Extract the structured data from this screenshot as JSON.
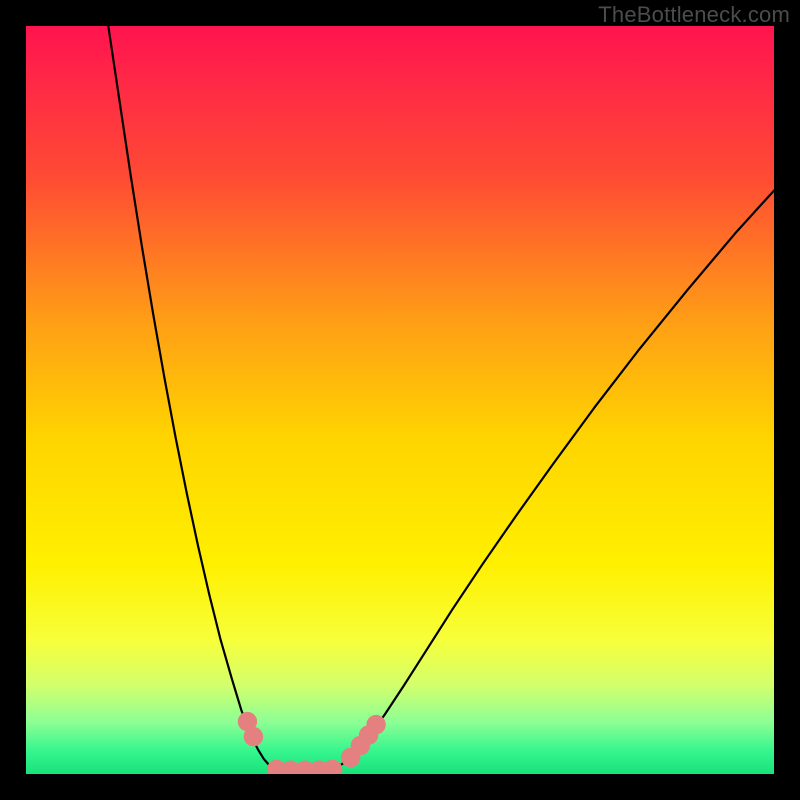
{
  "watermark": "TheBottleneck.com",
  "chart_data": {
    "type": "line",
    "title": "",
    "xlabel": "",
    "ylabel": "",
    "xlim": [
      0,
      100
    ],
    "ylim": [
      0,
      100
    ],
    "grid": false,
    "legend": false,
    "gradient_stops": [
      {
        "offset": 0.0,
        "color": "#ff1450"
      },
      {
        "offset": 0.2,
        "color": "#ff4a34"
      },
      {
        "offset": 0.4,
        "color": "#ffa015"
      },
      {
        "offset": 0.55,
        "color": "#ffd400"
      },
      {
        "offset": 0.72,
        "color": "#fff000"
      },
      {
        "offset": 0.82,
        "color": "#f7ff3a"
      },
      {
        "offset": 0.88,
        "color": "#d4ff6b"
      },
      {
        "offset": 0.93,
        "color": "#8dff94"
      },
      {
        "offset": 0.97,
        "color": "#35f58e"
      },
      {
        "offset": 1.0,
        "color": "#18e27b"
      }
    ],
    "series": [
      {
        "name": "left-curve",
        "stroke": "#000000",
        "stroke_width": 2.2,
        "x": [
          11.0,
          12.5,
          14.0,
          15.5,
          17.0,
          18.5,
          20.0,
          21.5,
          23.0,
          24.5,
          26.0,
          27.5,
          28.8,
          30.0,
          31.0,
          31.8,
          32.5,
          33.0,
          33.4
        ],
        "y": [
          100.0,
          90.0,
          80.0,
          70.5,
          61.5,
          53.0,
          45.0,
          37.5,
          30.5,
          24.0,
          18.0,
          12.8,
          8.5,
          5.3,
          3.3,
          2.0,
          1.2,
          0.7,
          0.5
        ]
      },
      {
        "name": "flat-bottom",
        "stroke": "#000000",
        "stroke_width": 2.2,
        "x": [
          33.4,
          35.0,
          37.0,
          39.0,
          41.0
        ],
        "y": [
          0.5,
          0.4,
          0.4,
          0.4,
          0.5
        ]
      },
      {
        "name": "right-curve",
        "stroke": "#000000",
        "stroke_width": 2.2,
        "x": [
          41.0,
          42.5,
          44.0,
          46.0,
          48.0,
          50.5,
          53.5,
          57.0,
          61.0,
          65.5,
          70.5,
          76.0,
          82.0,
          88.5,
          95.0,
          100.0
        ],
        "y": [
          0.5,
          1.5,
          3.0,
          5.2,
          8.0,
          11.8,
          16.5,
          22.0,
          28.0,
          34.5,
          41.5,
          49.0,
          56.8,
          64.8,
          72.5,
          78.0
        ]
      }
    ],
    "markers": [
      {
        "cx": 29.6,
        "cy": 7.0,
        "r": 1.3,
        "fill": "#e58080"
      },
      {
        "cx": 30.4,
        "cy": 5.0,
        "r": 1.3,
        "fill": "#e58080"
      },
      {
        "cx": 33.5,
        "cy": 0.6,
        "r": 1.3,
        "fill": "#e58080"
      },
      {
        "cx": 35.4,
        "cy": 0.5,
        "r": 1.3,
        "fill": "#e58080"
      },
      {
        "cx": 37.3,
        "cy": 0.5,
        "r": 1.3,
        "fill": "#e58080"
      },
      {
        "cx": 39.2,
        "cy": 0.5,
        "r": 1.3,
        "fill": "#e58080"
      },
      {
        "cx": 41.0,
        "cy": 0.6,
        "r": 1.3,
        "fill": "#e58080"
      },
      {
        "cx": 43.4,
        "cy": 2.2,
        "r": 1.3,
        "fill": "#e58080"
      },
      {
        "cx": 44.7,
        "cy": 3.8,
        "r": 1.3,
        "fill": "#e58080"
      },
      {
        "cx": 45.8,
        "cy": 5.2,
        "r": 1.3,
        "fill": "#e58080"
      },
      {
        "cx": 46.8,
        "cy": 6.6,
        "r": 1.3,
        "fill": "#e58080"
      }
    ]
  }
}
